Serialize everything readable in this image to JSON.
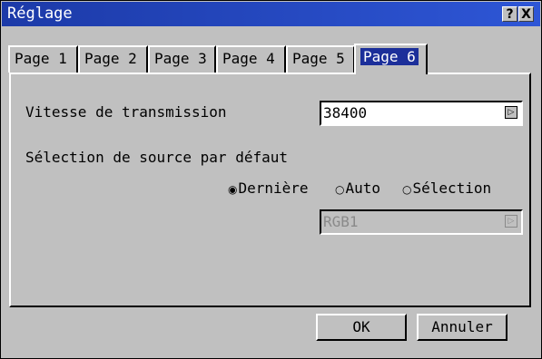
{
  "window": {
    "title": "Réglage",
    "help_label": "?",
    "close_label": "X"
  },
  "tabs": [
    {
      "label": "Page 1"
    },
    {
      "label": "Page 2"
    },
    {
      "label": "Page 3"
    },
    {
      "label": "Page 4"
    },
    {
      "label": "Page 5"
    },
    {
      "label": "Page 6",
      "active": true
    }
  ],
  "baud": {
    "label": "Vitesse de transmission",
    "value": "38400"
  },
  "source": {
    "label": "Sélection de source par défaut",
    "options": [
      {
        "label": "Dernière",
        "selected": true
      },
      {
        "label": "Auto",
        "selected": false
      },
      {
        "label": "Sélection",
        "selected": false
      }
    ],
    "selection_value": "RGB1"
  },
  "buttons": {
    "ok": "OK",
    "cancel": "Annuler"
  },
  "icons": {
    "radio_on": "◉",
    "radio_off": "○",
    "dropdown": "▷"
  }
}
